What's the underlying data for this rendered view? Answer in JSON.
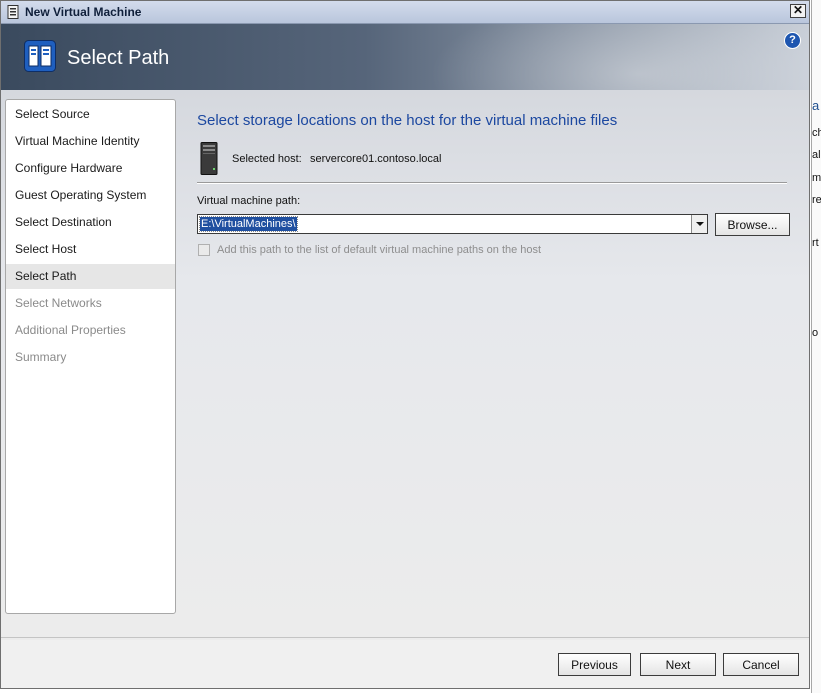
{
  "window": {
    "title": "New Virtual Machine",
    "close_symbol": "✕"
  },
  "header": {
    "title": "Select Path",
    "icon": "wizard-pages-icon",
    "help_symbol": "?"
  },
  "nav": {
    "items": [
      {
        "label": "Select Source",
        "state": "done"
      },
      {
        "label": "Virtual Machine Identity",
        "state": "done"
      },
      {
        "label": "Configure Hardware",
        "state": "done"
      },
      {
        "label": "Guest Operating System",
        "state": "done"
      },
      {
        "label": "Select Destination",
        "state": "done"
      },
      {
        "label": "Select Host",
        "state": "done"
      },
      {
        "label": "Select Path",
        "state": "current"
      },
      {
        "label": "Select Networks",
        "state": "disabled"
      },
      {
        "label": "Additional Properties",
        "state": "disabled"
      },
      {
        "label": "Summary",
        "state": "disabled"
      }
    ]
  },
  "main": {
    "heading": "Select storage locations on the host for the virtual machine files",
    "host_label": "Selected host:",
    "host_value": "servercore01.contoso.local",
    "path_label": "Virtual machine path:",
    "path_value": "E:\\VirtualMachines\\",
    "browse_label": "Browse...",
    "checkbox_label": "Add this path to the list of default virtual machine paths on the host",
    "checkbox_checked": false
  },
  "footer": {
    "previous_label": "Previous",
    "next_label": "Next",
    "cancel_label": "Cancel"
  },
  "background_fragments": [
    "a",
    "ch",
    "al",
    "m",
    "re",
    "rt",
    "o"
  ],
  "colors": {
    "accent": "#1c48a0",
    "selection": "#1f4fa0",
    "disabled_text": "#8a8a8a"
  }
}
